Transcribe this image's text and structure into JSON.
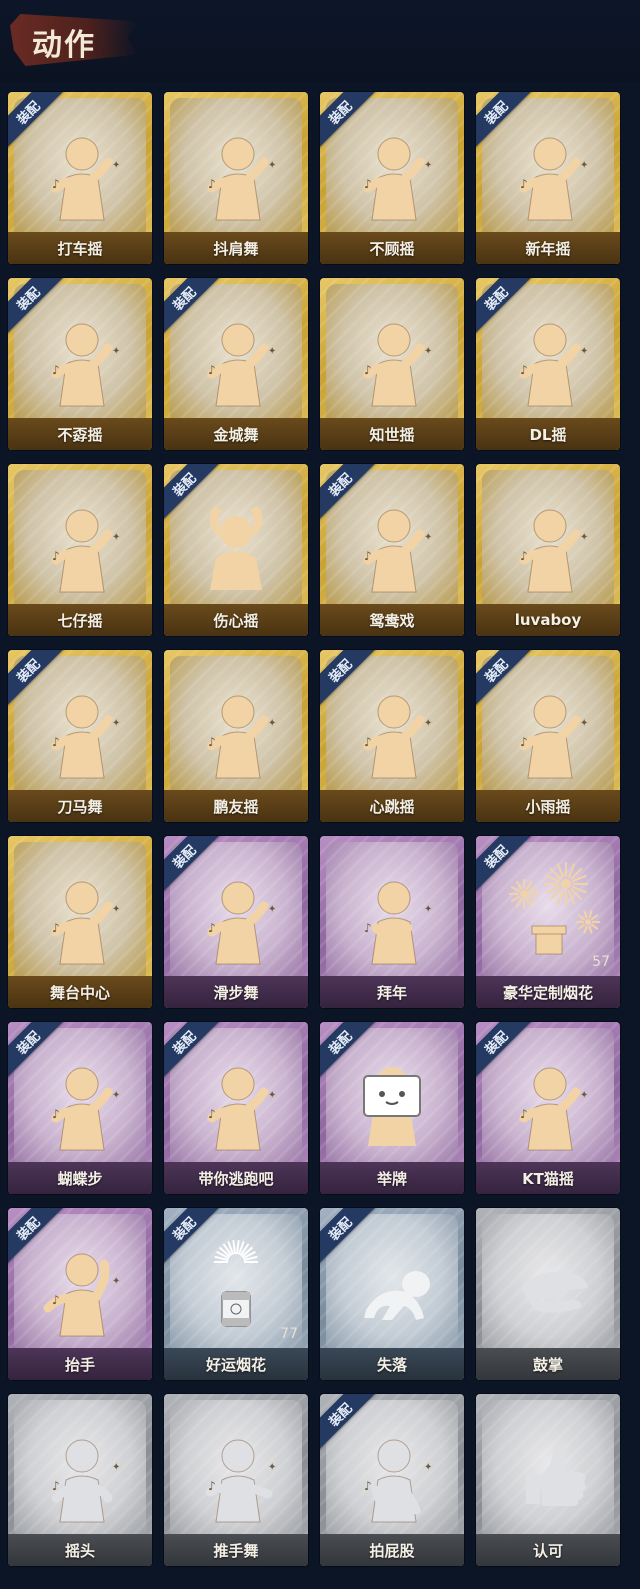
{
  "header": {
    "title": "动作"
  },
  "badge_label": "装配",
  "colors": {
    "background": "#0c1526",
    "gold": "#c9a233",
    "purple": "#8e679f",
    "blue": "#7a8b9c",
    "gray": "#8a8e94",
    "badge": "#243a63"
  },
  "cards": [
    {
      "label": "打车摇",
      "tier": "gold",
      "equipped": true,
      "icon": "dance-figure-icon"
    },
    {
      "label": "抖肩舞",
      "tier": "gold",
      "equipped": false,
      "icon": "dance-figure-icon"
    },
    {
      "label": "不顾摇",
      "tier": "gold",
      "equipped": true,
      "icon": "dance-figure-icon"
    },
    {
      "label": "新年摇",
      "tier": "gold",
      "equipped": true,
      "icon": "dance-figure-icon"
    },
    {
      "label": "不孬摇",
      "tier": "gold",
      "equipped": true,
      "icon": "dance-figure-icon"
    },
    {
      "label": "金城舞",
      "tier": "gold",
      "equipped": true,
      "icon": "dance-figure-icon"
    },
    {
      "label": "知世摇",
      "tier": "gold",
      "equipped": false,
      "icon": "dance-figure-icon"
    },
    {
      "label": "DL摇",
      "tier": "gold",
      "equipped": true,
      "icon": "dance-figure-icon"
    },
    {
      "label": "七仔摇",
      "tier": "gold",
      "equipped": false,
      "icon": "dance-figure-icon"
    },
    {
      "label": "伤心摇",
      "tier": "gold",
      "equipped": true,
      "icon": "heart-hands-figure-icon"
    },
    {
      "label": "鸳鸯戏",
      "tier": "gold",
      "equipped": true,
      "icon": "dance-figure-icon"
    },
    {
      "label": "luvaboy",
      "tier": "gold",
      "equipped": false,
      "icon": "dance-figure-icon"
    },
    {
      "label": "刀马舞",
      "tier": "gold",
      "equipped": true,
      "icon": "dance-figure-icon"
    },
    {
      "label": "鹏友摇",
      "tier": "gold",
      "equipped": false,
      "icon": "dance-figure-icon"
    },
    {
      "label": "心跳摇",
      "tier": "gold",
      "equipped": true,
      "icon": "dance-figure-icon"
    },
    {
      "label": "小雨摇",
      "tier": "gold",
      "equipped": true,
      "icon": "dance-figure-icon"
    },
    {
      "label": "舞台中心",
      "tier": "gold",
      "equipped": false,
      "icon": "dance-figure-icon"
    },
    {
      "label": "滑步舞",
      "tier": "purple",
      "equipped": true,
      "icon": "dance-figure-icon"
    },
    {
      "label": "拜年",
      "tier": "purple",
      "equipped": false,
      "icon": "bow-figure-icon"
    },
    {
      "label": "豪华定制烟花",
      "tier": "purple",
      "equipped": true,
      "icon": "fireworks-icon",
      "count": "57"
    },
    {
      "label": "蝴蝶步",
      "tier": "purple",
      "equipped": true,
      "icon": "dance-figure-icon"
    },
    {
      "label": "带你逃跑吧",
      "tier": "purple",
      "equipped": true,
      "icon": "dance-figure-icon"
    },
    {
      "label": "举牌",
      "tier": "purple",
      "equipped": true,
      "icon": "sign-figure-icon"
    },
    {
      "label": "KT猫摇",
      "tier": "purple",
      "equipped": true,
      "icon": "dance-figure-icon"
    },
    {
      "label": "抬手",
      "tier": "purple",
      "equipped": true,
      "icon": "raise-hand-figure-icon"
    },
    {
      "label": "好运烟花",
      "tier": "blue",
      "equipped": true,
      "icon": "firework-canister-icon",
      "count": "77"
    },
    {
      "label": "失落",
      "tier": "blue",
      "equipped": true,
      "icon": "crawling-figure-icon"
    },
    {
      "label": "鼓掌",
      "tier": "gray",
      "equipped": false,
      "icon": "clapping-hands-icon"
    },
    {
      "label": "摇头",
      "tier": "gray",
      "equipped": false,
      "icon": "shake-head-figure-icon"
    },
    {
      "label": "推手舞",
      "tier": "gray",
      "equipped": false,
      "icon": "push-hands-figure-icon"
    },
    {
      "label": "拍屁股",
      "tier": "gray",
      "equipped": true,
      "icon": "pat-figure-icon"
    },
    {
      "label": "认可",
      "tier": "gray",
      "equipped": false,
      "icon": "thumbs-up-icon"
    }
  ]
}
